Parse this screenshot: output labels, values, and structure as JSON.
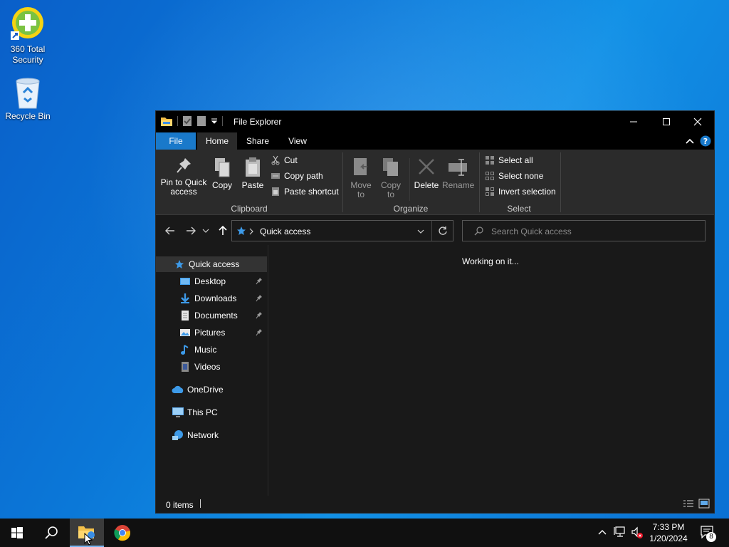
{
  "desktop": {
    "icons": [
      {
        "label": "360 Total Security",
        "icon": "360-security-icon"
      },
      {
        "label": "Recycle Bin",
        "icon": "recycle-bin-icon"
      }
    ]
  },
  "window": {
    "title": "File Explorer",
    "tabs": {
      "file": "File",
      "home": "Home",
      "share": "Share",
      "view": "View"
    },
    "ribbon": {
      "clipboard": {
        "group_label": "Clipboard",
        "pin_label": "Pin to Quick access",
        "copy_label": "Copy",
        "paste_label": "Paste",
        "cut_label": "Cut",
        "copy_path_label": "Copy path",
        "paste_shortcut_label": "Paste shortcut"
      },
      "organize": {
        "group_label": "Organize",
        "move_to_label": "Move to",
        "copy_to_label": "Copy to",
        "delete_label": "Delete",
        "rename_label": "Rename"
      },
      "select": {
        "group_label": "Select",
        "select_all_label": "Select all",
        "select_none_label": "Select none",
        "invert_label": "Invert selection"
      }
    },
    "address": {
      "location": "Quick access"
    },
    "search": {
      "placeholder": "Search Quick access"
    },
    "nav": {
      "quick_access": "Quick access",
      "pinned": [
        {
          "label": "Desktop",
          "icon": "desktop-folder-icon",
          "pinned": true
        },
        {
          "label": "Downloads",
          "icon": "downloads-folder-icon",
          "pinned": true
        },
        {
          "label": "Documents",
          "icon": "documents-folder-icon",
          "pinned": true
        },
        {
          "label": "Pictures",
          "icon": "pictures-folder-icon",
          "pinned": true
        },
        {
          "label": "Music",
          "icon": "music-folder-icon",
          "pinned": false
        },
        {
          "label": "Videos",
          "icon": "videos-folder-icon",
          "pinned": false
        }
      ],
      "onedrive": "OneDrive",
      "this_pc": "This PC",
      "network": "Network"
    },
    "content": {
      "message": "Working on it..."
    },
    "status": {
      "item_count": "0 items"
    }
  },
  "taskbar": {
    "time": "7:33 PM",
    "date": "1/20/2024",
    "notification_count": "8"
  },
  "colors": {
    "accent": "#1979ca",
    "window_bg": "#191919",
    "ribbon_bg": "#2b2b2b"
  }
}
